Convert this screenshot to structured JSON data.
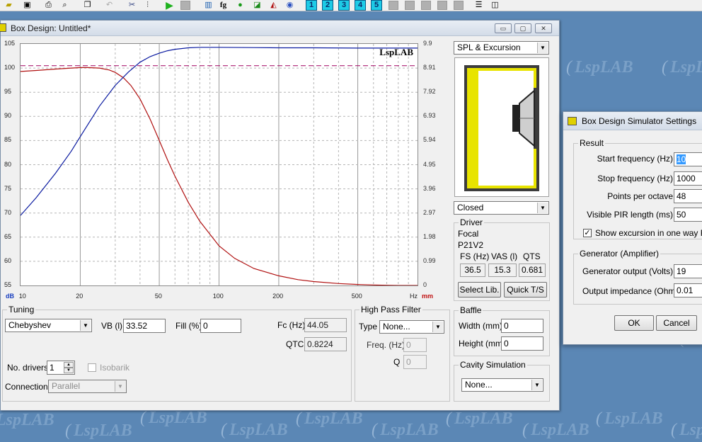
{
  "watermark": "LspLAB",
  "toolbar": {
    "fg_label": "fg",
    "numbered_buttons": [
      "1",
      "2",
      "3",
      "4",
      "5"
    ]
  },
  "window": {
    "title": "Box Design: Untitled*",
    "minimize_symbol": "▭",
    "maximize_symbol": "▢",
    "close_symbol": "✕"
  },
  "colors": {
    "spl_curve": "#b01010",
    "excursion_curve": "#0a1aa0",
    "reference_line": "#a00060",
    "enclosure_fill": "#e8e400",
    "enclosure_border": "#3c3c3c",
    "desktop": "#5b87b5"
  },
  "chart_data": {
    "type": "line",
    "logo": "LspLAB",
    "x_scale": "log",
    "x_unit": "Hz",
    "xlim": [
      10,
      1000
    ],
    "x_ticks": [
      "10",
      "20",
      "50",
      "100",
      "200",
      "500",
      "Hz"
    ],
    "y_left_unit": "dB",
    "y_left_ticks": [
      "105",
      "100",
      "95",
      "90",
      "85",
      "80",
      "75",
      "70",
      "65",
      "60",
      "55"
    ],
    "ylim_left": [
      55,
      105
    ],
    "y_right_unit": "mm",
    "y_right_ticks": [
      "9.9",
      "8.91",
      "7.92",
      "6.93",
      "5.94",
      "4.95",
      "3.96",
      "2.97",
      "1.98",
      "0.99",
      "0"
    ],
    "ylim_right": [
      0,
      9.9
    ],
    "reference_line_db": 100.5,
    "grid": true,
    "series": [
      {
        "axis": "left",
        "x": [
          10,
          12,
          15,
          18,
          20,
          22,
          25,
          28,
          30,
          33,
          36,
          40,
          45,
          50,
          55,
          60,
          70,
          80,
          100,
          120,
          150,
          200,
          250,
          300,
          400,
          500,
          600,
          700,
          800,
          1000
        ],
        "y": [
          99.3,
          99.5,
          99.8,
          100.0,
          100.1,
          100.1,
          100.0,
          99.6,
          99.1,
          98.0,
          96.4,
          93.6,
          89.4,
          85.0,
          81.0,
          77.6,
          72.2,
          68.3,
          63.2,
          60.6,
          58.5,
          57.0,
          56.2,
          55.8,
          55.4,
          55.2,
          55.1,
          55.05,
          55.0,
          55.0
        ]
      },
      {
        "axis": "right",
        "x": [
          10,
          12,
          15,
          18,
          20,
          25,
          30,
          35,
          40,
          45,
          50,
          55,
          60,
          70,
          80,
          100,
          150,
          200,
          300,
          500,
          700,
          1000
        ],
        "y": [
          2.87,
          3.6,
          4.6,
          5.5,
          6.1,
          7.35,
          8.2,
          8.75,
          9.15,
          9.38,
          9.52,
          9.62,
          9.68,
          9.74,
          9.76,
          9.76,
          9.75,
          9.74,
          9.74,
          9.73,
          9.73,
          9.73
        ]
      }
    ]
  },
  "right_panel": {
    "view_select": "SPL & Excursion",
    "box_type": "Closed",
    "driver": {
      "label": "Driver",
      "brand": "Focal",
      "model": "P21V2",
      "fs_label": "FS (Hz)",
      "vas_label": "VAS (l)",
      "qts_label": "QTS",
      "fs": "36.5",
      "vas": "15.3",
      "qts": "0.681",
      "select_lib_button": "Select Lib.",
      "quick_ts_button": "Quick T/S"
    }
  },
  "tuning": {
    "label": "Tuning",
    "alignment": "Chebyshev",
    "vb_label": "VB (l)",
    "vb": "33.52",
    "fill_label": "Fill (%)",
    "fill": "0",
    "fc_label": "Fc (Hz)",
    "fc": "44.05",
    "qtc_label": "QTC",
    "qtc": "0.8224",
    "drivers_label": "No. drivers",
    "drivers": "1",
    "isobarik_label": "Isobarik",
    "connection_label": "Connection",
    "connection": "Parallel"
  },
  "high_pass": {
    "label": "High Pass Filter",
    "type_label": "Type",
    "type": "None...",
    "freq_label": "Freq. (Hz)",
    "freq": "0",
    "q_label": "Q",
    "q": "0"
  },
  "baffle": {
    "label": "Baffle",
    "width_label": "Width (mm)",
    "width": "0",
    "height_label": "Height (mm)",
    "height": "0"
  },
  "cavity": {
    "label": "Cavity Simulation",
    "value": "None..."
  },
  "dialog": {
    "title": "Box Design Simulator Settings",
    "result_label": "Result",
    "start_freq_label": "Start frequency (Hz)",
    "start_freq": "10",
    "stop_freq_label": "Stop frequency (Hz)",
    "stop_freq": "1000",
    "points_label": "Points per octave",
    "points": "48",
    "pir_label": "Visible PIR length (ms)",
    "pir": "50",
    "excursion_label": "Show excursion in one way RMS",
    "excursion_checked": "✓",
    "generator_label": "Generator (Amplifier)",
    "gen_output_label": "Generator output (Volts)",
    "gen_output": "19",
    "out_imp_label": "Output impedance (Ohms)",
    "out_imp": "0.01",
    "ok_button": "OK",
    "cancel_button": "Cancel"
  }
}
